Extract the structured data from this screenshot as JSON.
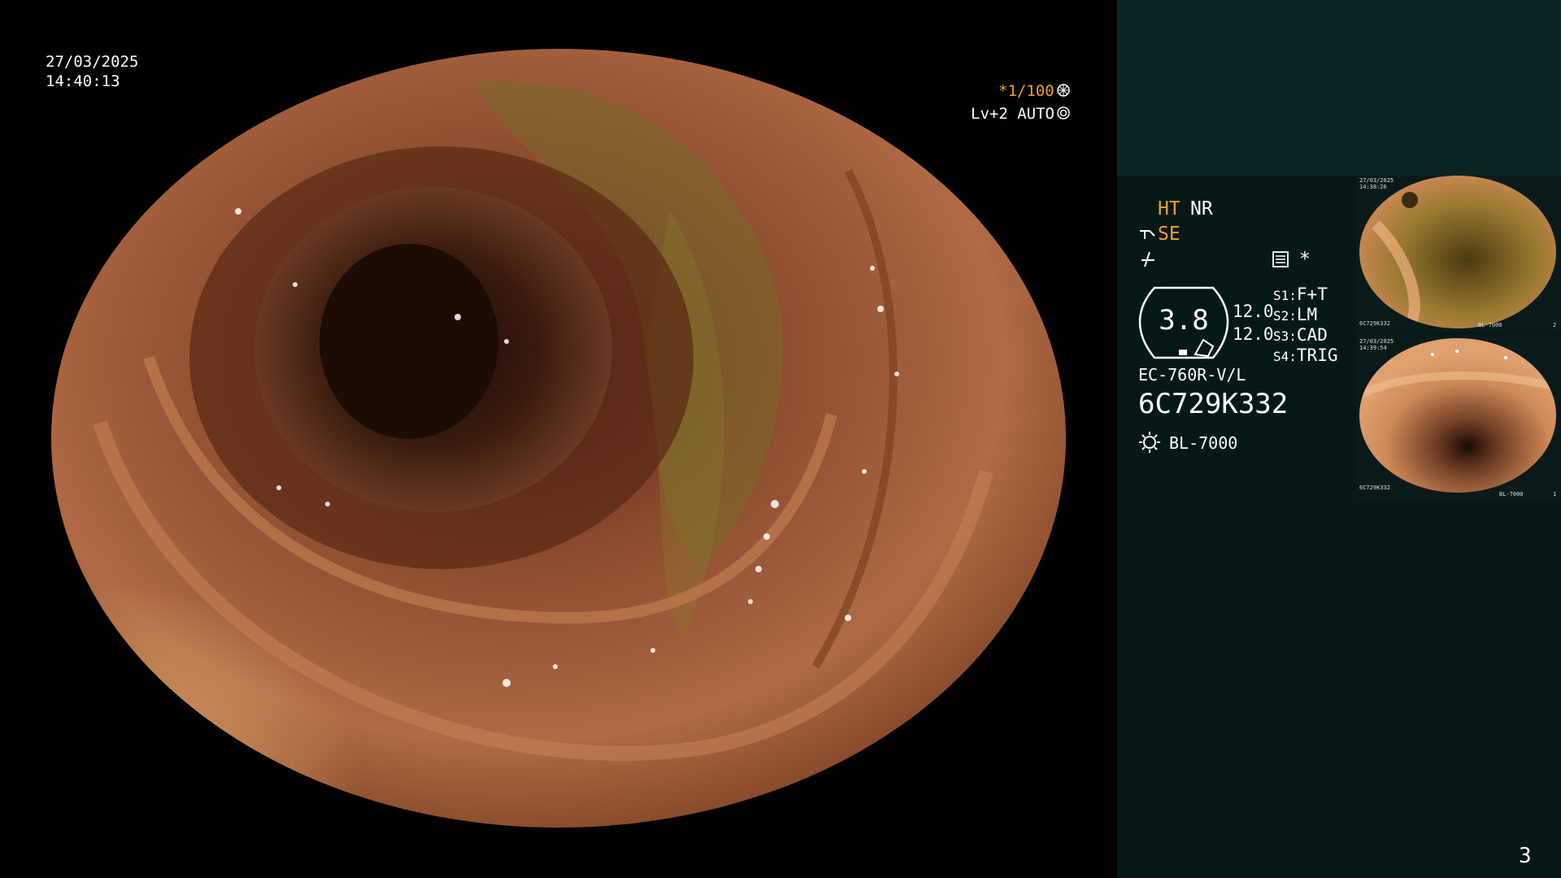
{
  "overlay": {
    "date": "27/03/2025",
    "time": "14:40:13",
    "shutter": "*1/100",
    "level_mode": "Lv+2 AUTO"
  },
  "panel": {
    "mode_ht": "HT",
    "mode_nr": "NR",
    "mode_se": "SE",
    "gauge_value": "3.8",
    "readout_1": "12.0",
    "readout_2": "12.0",
    "switches": [
      {
        "key": "S1:",
        "value": "F+T"
      },
      {
        "key": "S2:",
        "value": "LM"
      },
      {
        "key": "S3:",
        "value": "CAD"
      },
      {
        "key": "S4:",
        "value": "TRIG"
      }
    ],
    "scope_model": "EC-760R-V/L",
    "serial": "6C729K332",
    "light_source": "BL-7000",
    "page_number": "3",
    "asterisk": "*"
  },
  "thumbnails": [
    {
      "date": "27/03/2025",
      "time": "14:38:26",
      "serial": "6C729K332",
      "index": "2",
      "source": "BL-7000"
    },
    {
      "date": "27/03/2025",
      "time": "14:39:54",
      "serial": "6C729K332",
      "index": "1",
      "source": "BL-7000"
    }
  ],
  "colors": {
    "amber": "#f0a030",
    "panel_top": "#0b2424",
    "panel_bottom": "#051818"
  }
}
